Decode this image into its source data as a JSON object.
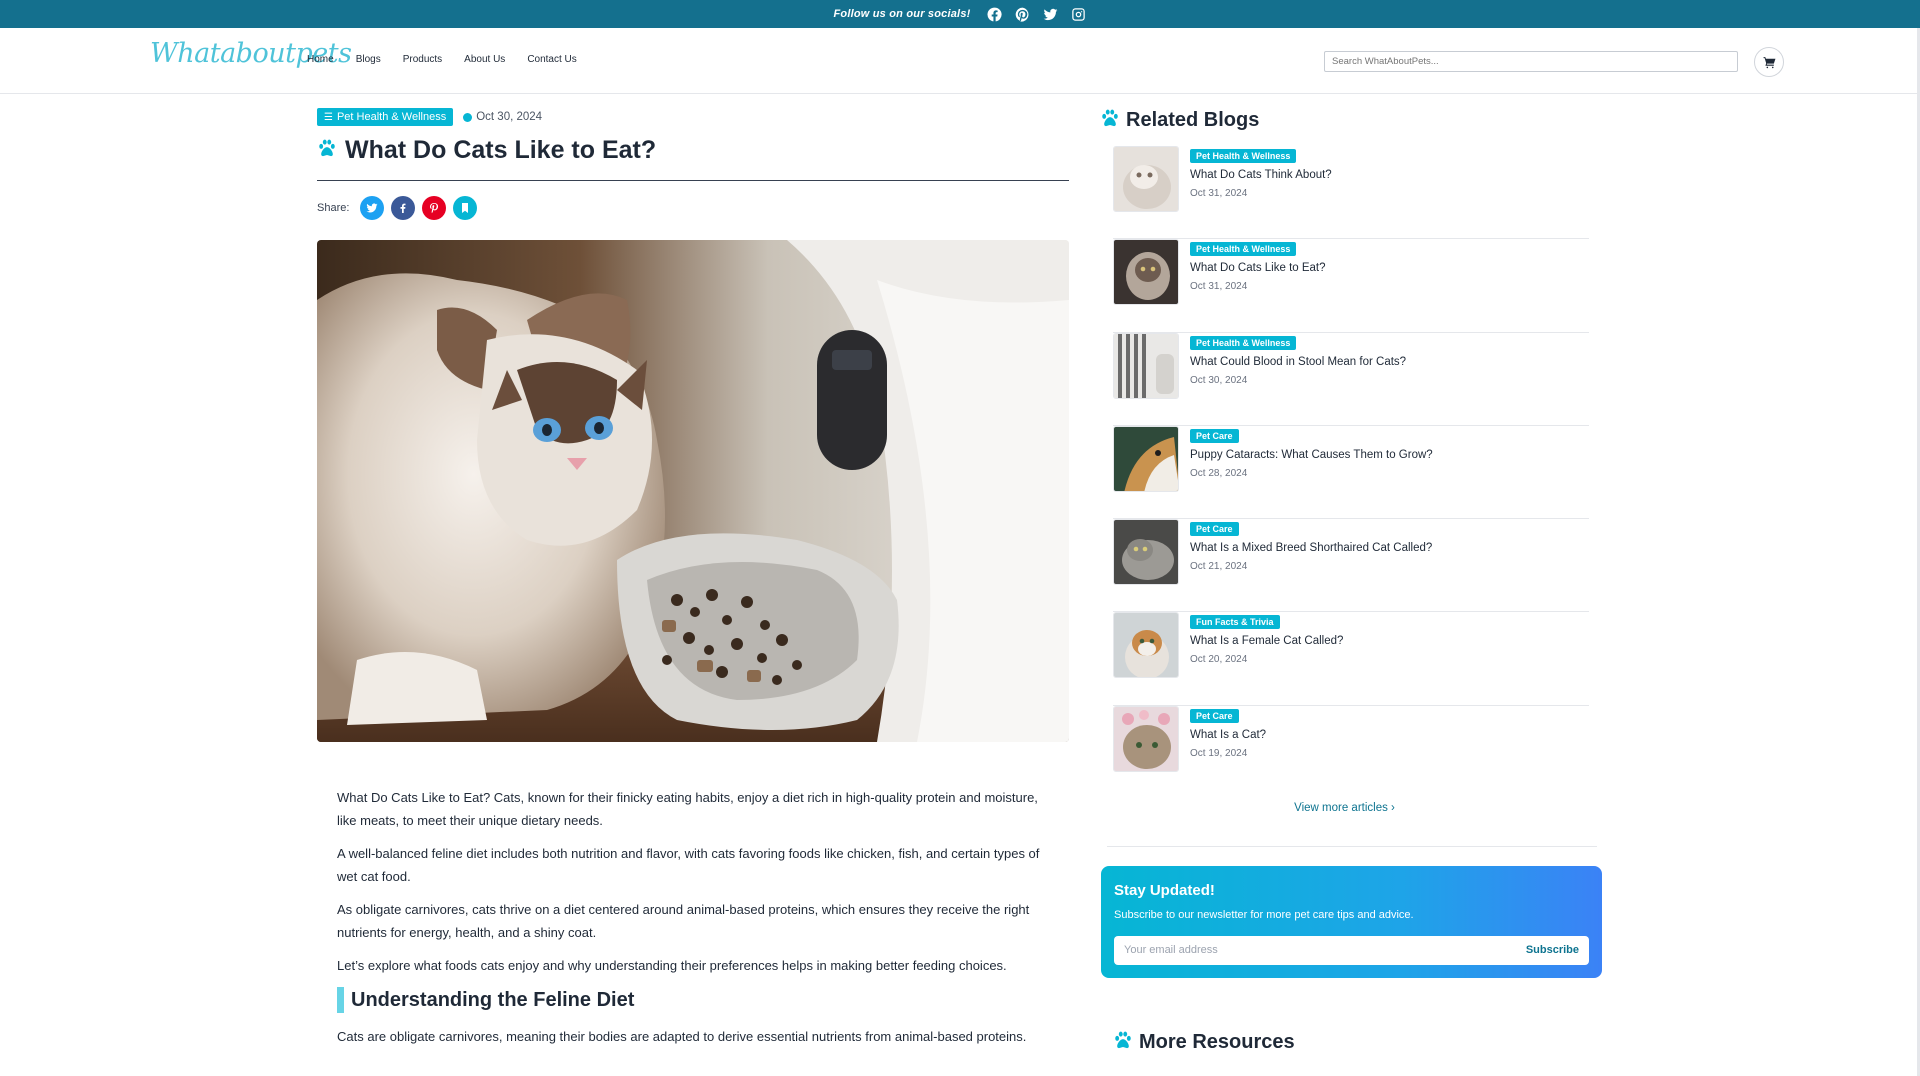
{
  "topbar": {
    "text": "Follow us on our socials!",
    "icons": [
      "facebook-icon",
      "pinterest-icon",
      "twitter-icon",
      "instagram-icon"
    ]
  },
  "header": {
    "logo": "Whataboutpets",
    "nav": [
      "Home",
      "Blogs",
      "Products",
      "About Us",
      "Contact Us"
    ],
    "search_placeholder": "Search WhatAboutPets..."
  },
  "article": {
    "category": "Pet Health & Wellness",
    "date": "Oct 30, 2024",
    "title": "What Do Cats Like to Eat?",
    "share_label": "Share:",
    "share_buttons": [
      {
        "name": "twitter",
        "color": "#1da1f2"
      },
      {
        "name": "facebook",
        "color": "#3b5998"
      },
      {
        "name": "pinterest",
        "color": "#e60023"
      },
      {
        "name": "bookmark",
        "color": "#06b6d4"
      }
    ],
    "paragraphs": [
      "What Do Cats Like to Eat? Cats, known for their finicky eating habits, enjoy a diet rich in high-quality protein and moisture, like meats, to meet their unique dietary needs.",
      "A well-balanced feline diet includes both nutrition and flavor, with cats favoring foods like chicken, fish, and certain types of wet cat food.",
      "As obligate carnivores, cats thrive on a diet centered around animal-based proteins, which ensures they receive the right nutrients for energy, health, and a shiny coat.",
      "Let’s explore what foods cats enjoy and why understanding their preferences helps in making better feeding choices."
    ],
    "section_heading": "Understanding the Feline Diet",
    "section_paragraph": "Cats are obligate carnivores, meaning their bodies are adapted to derive essential nutrients from animal-based proteins."
  },
  "sidebar": {
    "related_title": "Related Blogs",
    "related": [
      {
        "category": "Pet Health & Wellness",
        "title": "What Do Cats Think About?",
        "date": "Oct 31, 2024"
      },
      {
        "category": "Pet Health & Wellness",
        "title": "What Do Cats Like to Eat?",
        "date": "Oct 31, 2024"
      },
      {
        "category": "Pet Health & Wellness",
        "title": "What Could Blood in Stool Mean for Cats?",
        "date": "Oct 30, 2024"
      },
      {
        "category": "Pet Care",
        "title": "Puppy Cataracts: What Causes Them to Grow?",
        "date": "Oct 28, 2024"
      },
      {
        "category": "Pet Care",
        "title": "What Is a Mixed Breed Shorthaired Cat Called?",
        "date": "Oct 21, 2024"
      },
      {
        "category": "Fun Facts & Trivia",
        "title": "What Is a Female Cat Called?",
        "date": "Oct 20, 2024"
      },
      {
        "category": "Pet Care",
        "title": "What Is a Cat?",
        "date": "Oct 19, 2024"
      }
    ],
    "view_more": "View more articles ›",
    "newsletter": {
      "title": "Stay Updated!",
      "subtitle": "Subscribe to our newsletter for more pet care tips and advice.",
      "placeholder": "Your email address",
      "button": "Subscribe"
    },
    "more_resources_title": "More Resources"
  },
  "colors": {
    "brand_dark": "#14708e",
    "accent": "#06b6d4"
  }
}
